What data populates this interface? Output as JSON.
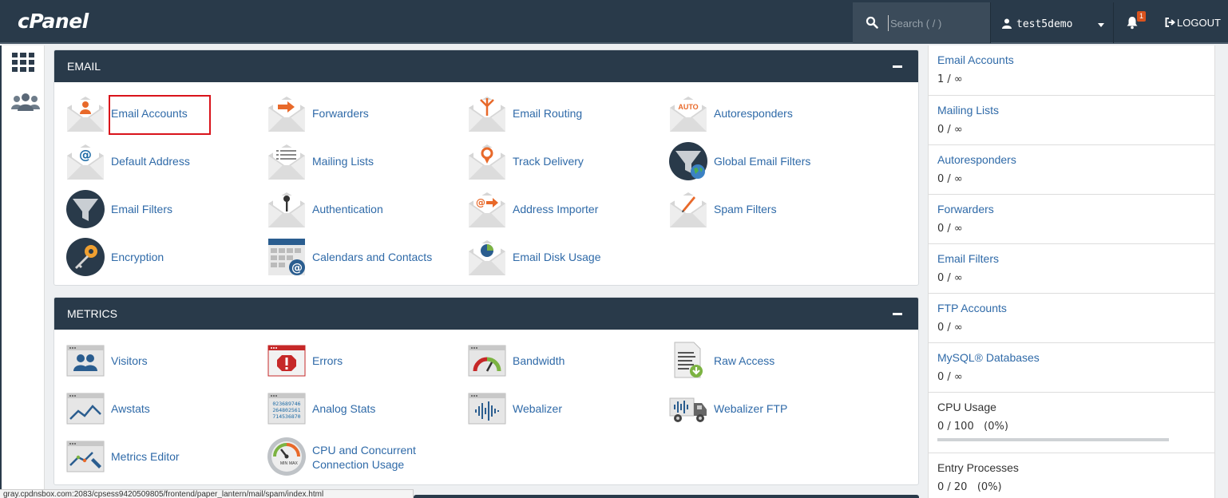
{
  "app": {
    "brand": "cPanel"
  },
  "header": {
    "search_placeholder": "Search ( / )",
    "username": "test5demo",
    "notification_count": "1",
    "logout_label": "LOGOUT"
  },
  "email_panel": {
    "title": "EMAIL",
    "items": [
      {
        "label": "Email Accounts",
        "icon": "email-accounts-icon"
      },
      {
        "label": "Forwarders",
        "icon": "forwarders-icon"
      },
      {
        "label": "Email Routing",
        "icon": "email-routing-icon"
      },
      {
        "label": "Autoresponders",
        "icon": "autoresponders-icon"
      },
      {
        "label": "Default Address",
        "icon": "default-address-icon"
      },
      {
        "label": "Mailing Lists",
        "icon": "mailing-lists-icon"
      },
      {
        "label": "Track Delivery",
        "icon": "track-delivery-icon"
      },
      {
        "label": "Global Email Filters",
        "icon": "global-email-filters-icon"
      },
      {
        "label": "Email Filters",
        "icon": "email-filters-icon"
      },
      {
        "label": "Authentication",
        "icon": "authentication-icon"
      },
      {
        "label": "Address Importer",
        "icon": "address-importer-icon"
      },
      {
        "label": "Spam Filters",
        "icon": "spam-filters-icon"
      },
      {
        "label": "Encryption",
        "icon": "encryption-icon"
      },
      {
        "label": "Calendars and Contacts",
        "icon": "calendars-contacts-icon"
      },
      {
        "label": "Email Disk Usage",
        "icon": "email-disk-usage-icon"
      }
    ],
    "auto_badge": "AUTO"
  },
  "metrics_panel": {
    "title": "METRICS",
    "items": [
      {
        "label": "Visitors",
        "icon": "visitors-icon"
      },
      {
        "label": "Errors",
        "icon": "errors-icon"
      },
      {
        "label": "Bandwidth",
        "icon": "bandwidth-icon"
      },
      {
        "label": "Raw Access",
        "icon": "raw-access-icon"
      },
      {
        "label": "Awstats",
        "icon": "awstats-icon"
      },
      {
        "label": "Analog Stats",
        "icon": "analog-stats-icon"
      },
      {
        "label": "Webalizer",
        "icon": "webalizer-icon"
      },
      {
        "label": "Webalizer FTP",
        "icon": "webalizer-ftp-icon"
      },
      {
        "label": "Metrics Editor",
        "icon": "metrics-editor-icon"
      },
      {
        "label": "CPU and Concurrent Connection Usage",
        "icon": "cpu-usage-icon"
      }
    ],
    "analog_digits": [
      "023689746",
      "264802561",
      "714536870"
    ]
  },
  "stats": [
    {
      "title": "Email Accounts",
      "value": "1 / ∞"
    },
    {
      "title": "Mailing Lists",
      "value": "0 / ∞"
    },
    {
      "title": "Autoresponders",
      "value": "0 / ∞"
    },
    {
      "title": "Forwarders",
      "value": "0 / ∞"
    },
    {
      "title": "Email Filters",
      "value": "0 / ∞"
    },
    {
      "title": "FTP Accounts",
      "value": "0 / ∞"
    },
    {
      "title": "MySQL® Databases",
      "value": "0 / ∞"
    },
    {
      "title": "CPU Usage",
      "value": "0 / 100   (0%)",
      "progress": 0
    },
    {
      "title": "Entry Processes",
      "value": "0 / 20   (0%)"
    }
  ],
  "statusbar": {
    "url": "gray.cpdnsbox.com:2083/cpsess9420509805/frontend/paper_lantern/mail/spam/index.html"
  },
  "colors": {
    "header": "#293a4a",
    "link": "#2f6aa8",
    "accent": "#e8692a",
    "highlight": "#d9131b"
  }
}
